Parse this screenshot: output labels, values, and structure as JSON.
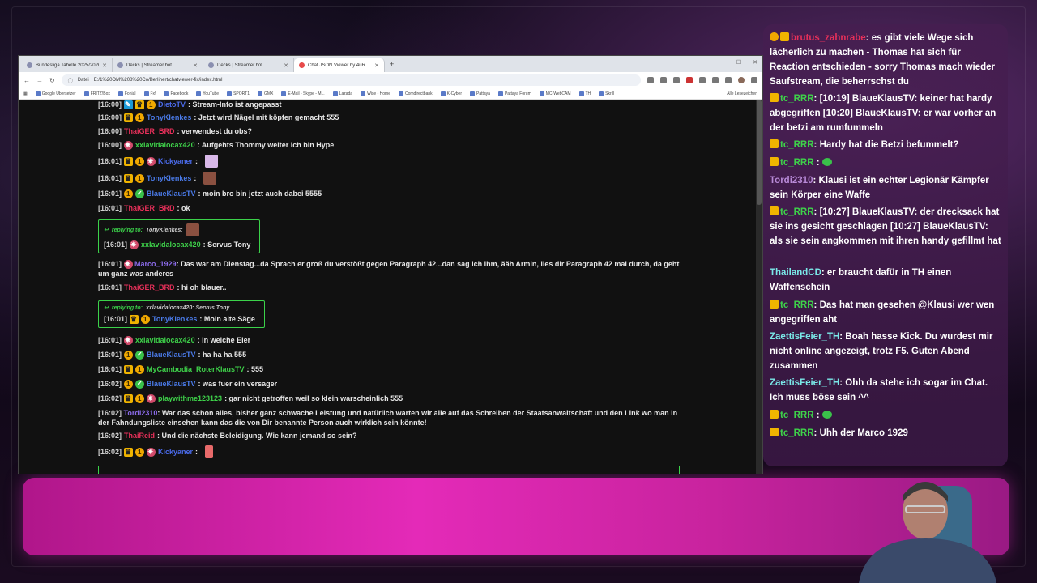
{
  "browser": {
    "tabs": [
      {
        "label": "Bundesliga Tabelle 2025/2026",
        "active": false
      },
      {
        "label": "Decks | Streamer.bot",
        "active": false
      },
      {
        "label": "Decks | Streamer.bot",
        "active": false
      },
      {
        "label": "Chat JSON Viewer by 4uR",
        "active": true
      }
    ],
    "new_tab": "+",
    "address_prefix": "Datei",
    "url": "E:/1%20OM%208%20Co/Berlinert/chatviewer-fix/index.html",
    "bookmarks": [
      "Google Übersetzer",
      "FRITZ!Box",
      "Fonial",
      "Fx!",
      "Facebook",
      "YouTube",
      "SPORT1",
      "GMX",
      "E-Mail - Skype - M...",
      "Lazada",
      "Wise - Home",
      "Comdirectbank",
      "K-Cyber",
      "Pattaya",
      "Pattaya Forum",
      "MC-WebCAM",
      "TH",
      "Skrill"
    ],
    "bookmarks_right": "Alle Lesezeichen"
  },
  "chat": [
    {
      "time": "[16:00]",
      "badges": [
        "pencil",
        "crown",
        "coin"
      ],
      "user": "DietoTV",
      "color": "#4a6ae8",
      "text": ": Stream-Info ist angepasst"
    },
    {
      "time": "[16:00]",
      "badges": [
        "crown",
        "coin"
      ],
      "user": "TonyKlenkes",
      "color": "#4a7ae8",
      "text": ": Jetzt wird Nägel mit köpfen gemacht 555"
    },
    {
      "time": "[16:00]",
      "badges": [],
      "user": "ThaiGER_BRD",
      "color": "#e8305a",
      "text": ": verwendest du obs?"
    },
    {
      "time": "[16:00]",
      "badges": [
        "star"
      ],
      "user": "xxlavidalocax420",
      "color": "#3ed24a",
      "text": ": Aufgehts Thommy weiter ich bin Hype"
    },
    {
      "time": "[16:01]",
      "badges": [
        "crown",
        "coin",
        "star"
      ],
      "user": "Kickyaner",
      "color": "#4a6ae8",
      "text": " :",
      "emote": "pink"
    },
    {
      "time": "[16:01]",
      "badges": [
        "crown",
        "coin"
      ],
      "user": "TonyKlenkes",
      "color": "#4a7ae8",
      "text": " :",
      "emote": "brown"
    },
    {
      "time": "[16:01]",
      "badges": [
        "coin",
        "check"
      ],
      "user": "BlaueKlausTV",
      "color": "#4a7ae8",
      "text": ": moin bro bin jetzt auch dabei 5555"
    },
    {
      "time": "[16:01]",
      "badges": [],
      "user": "ThaiGER_BRD",
      "color": "#e8305a",
      "text": ": ok"
    },
    {
      "time": "[16:01]",
      "badges": [
        "star"
      ],
      "user": "Marco_1929",
      "color": "#8a6ae8",
      "text": ": Das war am Dienstag...da Sprach er groß du verstößt gegen Paragraph 42...dan sag ich ihm, ääh Armin, lies dir Paragraph 42 mal durch, da geht um ganz was anderes"
    },
    {
      "time": "[16:01]",
      "badges": [],
      "user": "ThaiGER_BRD",
      "color": "#e8305a",
      "text": ": hi oh blauer.."
    },
    {
      "time": "[16:01]",
      "badges": [
        "star"
      ],
      "user": "xxlavidalocax420",
      "color": "#3ed24a",
      "text": ": In welche Eier"
    },
    {
      "time": "[16:01]",
      "badges": [
        "coin",
        "check"
      ],
      "user": "BlaueKlausTV",
      "color": "#4a7ae8",
      "text": ": ha ha ha 555"
    },
    {
      "time": "[16:01]",
      "badges": [
        "crown",
        "coin"
      ],
      "user": "MyCambodia_RoterKlausTV",
      "color": "#3ed24a",
      "text": ": 555"
    },
    {
      "time": "[16:02]",
      "badges": [
        "coin",
        "check"
      ],
      "user": "BlaueKlausTV",
      "color": "#4a7ae8",
      "text": ": was fuer ein versager"
    },
    {
      "time": "[16:02]",
      "badges": [
        "crown",
        "coin",
        "star"
      ],
      "user": "playwithme123123",
      "color": "#3ed24a",
      "text": ": gar nicht getroffen weil so klein warscheinlich 555"
    },
    {
      "time": "[16:02]",
      "badges": [],
      "user": "Tordi2310",
      "color": "#8a6ae8",
      "text": ": War das schon alles, bisher ganz schwache Leistung und natürlich warten wir alle auf das Schreiben der Staatsanwaltschaft und den Link wo man in der Fahndungsliste einsehen kann das die von Dir benannte Person auch wirklich sein könnte!"
    },
    {
      "time": "[16:02]",
      "badges": [],
      "user": "ThaiReid",
      "color": "#e8305a",
      "text": ": Und die nächste Beleidigung. Wie kann jemand so sein?"
    },
    {
      "time": "[16:02]",
      "badges": [
        "crown",
        "coin",
        "star"
      ],
      "user": "Kickyaner",
      "color": "#4a6ae8",
      "text": " :",
      "emote": "hand"
    }
  ],
  "replies": [
    {
      "label": "replying to:",
      "target": "TonyKlenkes:",
      "time": "[16:01]",
      "user": "xxlavidalocax420",
      "color": "#3ed24a",
      "text": ": Servus Tony"
    },
    {
      "label": "replying to:",
      "target": "xxlavidalocax420: Servus Tony",
      "time": "[16:01]",
      "user": "TonyKlenkes",
      "color": "#4a7ae8",
      "text": ": Moin alte Säge"
    }
  ],
  "overlay": [
    {
      "user": "brutus_zahnrabe",
      "color": "#e8305a",
      "text": ": es gibt viele Wege sich lächerlich zu machen - Thomas hat sich für Reaction entschieden - sorry Thomas mach wieder Saufstream, die beherrschst du",
      "badges": 2
    },
    {
      "user": "tc_RRR",
      "color": "#3ed24a",
      "text": ": [10:19] BlaueKlausTV: keiner hat hardy abgegriffen [10:20] BlaueKlausTV: er war vorher an der betzi am rumfummeln",
      "badges": 1
    },
    {
      "user": "tc_RRR",
      "color": "#3ed24a",
      "text": ": Hardy hat die Betzi befummelt?",
      "badges": 1
    },
    {
      "user": "tc_RRR",
      "color": "#3ed24a",
      "text": " :",
      "badges": 1,
      "emote": true
    },
    {
      "user": "Tordi2310",
      "color": "#b88ad8",
      "text": ": Klausi ist ein echter Legionär Kämpfer sein Körper eine Waffe",
      "badges": 0
    },
    {
      "user": "tc_RRR",
      "color": "#3ed24a",
      "text": ": [10:27] BlaueKlausTV: der drecksack hat sie ins gesicht geschlagen [10:27] BlaueKlausTV: als sie sein angkommen mit ihren handy gefillmt hat",
      "badges": 1
    },
    {
      "user": "ThailandCD",
      "color": "#7ae8e8",
      "text": ": er braucht dafür in TH einen Waffenschein",
      "badges": 0
    },
    {
      "user": "tc_RRR",
      "color": "#3ed24a",
      "text": ": Das hat man gesehen @Klausi wer wen angegriffen aht",
      "badges": 1
    },
    {
      "user": "ZaettisFeier_TH",
      "color": "#7ae8e8",
      "text": ": Boah hasse Kick. Du wurdest mir nicht online angezeigt, trotz F5. Guten Abend zusammen",
      "badges": 0
    },
    {
      "user": "ZaettisFeier_TH",
      "color": "#7ae8e8",
      "text": ": Ohh da stehe ich sogar im Chat. Ich muss böse sein ^^",
      "badges": 0
    },
    {
      "user": "tc_RRR",
      "color": "#3ed24a",
      "text": " :",
      "badges": 1,
      "emote": true
    },
    {
      "user": "tc_RRR",
      "color": "#3ed24a",
      "text": ": Uhh der Marco 1929",
      "badges": 1
    }
  ]
}
